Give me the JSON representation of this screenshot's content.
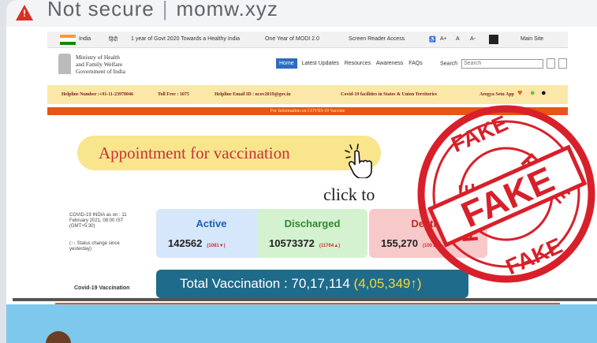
{
  "browser": {
    "warning_glyph": "!",
    "security": "Not secure",
    "domain": "momw.xyz"
  },
  "topbar": {
    "country": "India",
    "hindi": "हिंदी",
    "link1": "1 year of Govt 2020 Towards a Healthy India",
    "link2": "One Year of MODI 2.0",
    "screen_reader": "Screen Reader Access",
    "text_plus": "A+",
    "text_normal": "A",
    "text_minus": "A-",
    "main_site": "Main Site",
    "flag_colors": [
      "#ff9933",
      "#ffffff",
      "#138808"
    ]
  },
  "header": {
    "ministry_line1": "Ministry of Health",
    "ministry_line2": "and Family Welfare",
    "ministry_line3": "Government of India",
    "nav": [
      "Home",
      "Latest Updates",
      "Resources",
      "Awareness",
      "FAQs"
    ],
    "search_label": "Search",
    "search_placeholder": "Search"
  },
  "helpline": {
    "number": "Helpline Number :+91-11-23978046",
    "tollfree": "Toll Free : 1075",
    "email": "Helpline Email ID : ncov2019@gov.in",
    "facilities": "Covid-19 facilities in States & Union Territories",
    "app": "Arogya Setu App"
  },
  "banner": "For Information on COVID-19 Vaccine",
  "appointment": "Appointment for vaccination",
  "overlay_text": "click to",
  "status": {
    "as_on": "COVID-19 INDIA as on : 11 February 2021, 08:00 IST (GMT+5:30)",
    "change_note": "(↑↓ Status change since yesterday)"
  },
  "stats": {
    "active": {
      "label": "Active",
      "value": "142562",
      "change": "(1081▼)"
    },
    "discharged": {
      "label": "Discharged",
      "value": "10573372",
      "change": "(11764▲)"
    },
    "deaths": {
      "label": "Deaths",
      "value": "155,270",
      "change": "(100▲)"
    }
  },
  "vaccination": {
    "label": "Covid-19 Vaccination",
    "total": "Total Vaccination : 70,17,114",
    "increase": "(4,05,349↑)"
  },
  "stamp": {
    "word": "FAKE",
    "color": "#d8202a"
  }
}
